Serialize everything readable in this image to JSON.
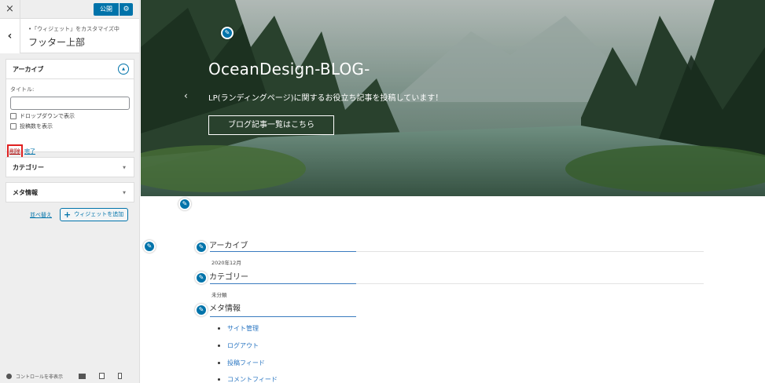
{
  "sidebar": {
    "close_label": "×",
    "publish_label": "公開",
    "publish_gear": "⚙",
    "back_label": "‹",
    "breadcrumb": "•「ウィジェット」をカスタマイズ中",
    "panel_title": "フッター上部",
    "widget_archive": {
      "title": "アーカイブ",
      "toggle": "▲",
      "title_label": "タイトル:",
      "title_value": "",
      "checkbox_dropdown": "ドロップダウンで表示",
      "checkbox_count": "投稿数を表示",
      "delete_label": "削除",
      "done_label": "完了"
    },
    "widget_category": {
      "title": "カテゴリー",
      "arrow": "▼"
    },
    "widget_meta": {
      "title": "メタ情報",
      "arrow": "▼"
    },
    "reorder_label": "並べ替え",
    "add_widget_plus": "+",
    "add_widget_label": "ウィジェットを追加",
    "hide_controls_label": "コントロールを非表示"
  },
  "preview": {
    "site_title": "OceanDesign-BLOG-",
    "tagline": "LP(ランディングページ)に関するお役立ち記事を投稿しています！",
    "hero_button": "ブログ記事一覧はこちら",
    "hero_arrow": "‹",
    "pencil_glyph": "✎",
    "footer_widgets": {
      "archive_title": "アーカイブ",
      "archive_item": "2020年12月",
      "category_title": "カテゴリー",
      "category_item": "未分類",
      "meta_title": "メタ情報",
      "meta_items": [
        "サイト管理",
        "ログアウト",
        "投稿フィード",
        "コメントフィード"
      ]
    }
  },
  "colors": {
    "accent": "#0073aa",
    "delete_highlight": "#e02020",
    "link": "#2a76c2"
  }
}
